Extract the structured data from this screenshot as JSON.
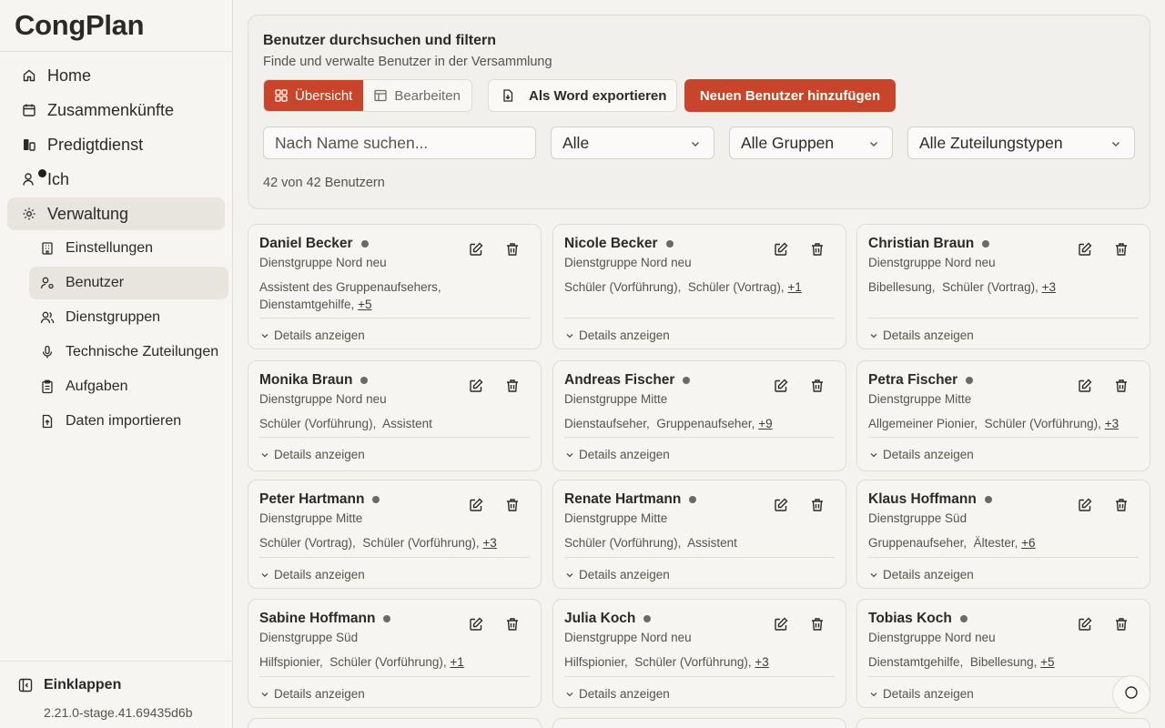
{
  "app": {
    "title": "CongPlan",
    "version": "2.21.0-stage.41.69435d6b"
  },
  "sidebar": {
    "items": [
      {
        "label": "Home",
        "icon": "home-icon"
      },
      {
        "label": "Zusammenkünfte",
        "icon": "calendar-icon"
      },
      {
        "label": "Predigtdienst",
        "icon": "ministry-icon"
      },
      {
        "label": "Ich",
        "icon": "user-icon"
      },
      {
        "label": "Verwaltung",
        "icon": "gear-icon"
      }
    ],
    "subitems": [
      {
        "label": "Einstellungen",
        "icon": "building-icon"
      },
      {
        "label": "Benutzer",
        "icon": "user-settings-icon"
      },
      {
        "label": "Dienstgruppen",
        "icon": "users-icon"
      },
      {
        "label": "Technische Zuteilungen",
        "icon": "microphone-icon"
      },
      {
        "label": "Aufgaben",
        "icon": "clipboard-icon"
      },
      {
        "label": "Daten importieren",
        "icon": "file-import-icon"
      }
    ],
    "collapse_label": "Einklappen"
  },
  "filter": {
    "title": "Benutzer durchsuchen und filtern",
    "subtitle": "Finde und verwalte Benutzer in der Versammlung",
    "view_overview": "Übersicht",
    "view_edit": "Bearbeiten",
    "export_label": "Als Word exportieren",
    "add_label": "Neuen Benutzer hinzufügen",
    "search_placeholder": "Nach Name suchen...",
    "select_status": "Alle",
    "select_groups": "Alle Gruppen",
    "select_types": "Alle Zuteilungstypen",
    "count_text": "42 von 42 Benutzern"
  },
  "details_label": "Details anzeigen",
  "users": [
    {
      "name": "Daniel Becker",
      "group": "Dienstgruppe Nord neu",
      "roles": [
        "Assistent des Gruppenaufsehers,",
        "Dienstamtgehilfe,"
      ],
      "more": "+5"
    },
    {
      "name": "Nicole Becker",
      "group": "Dienstgruppe Nord neu",
      "roles": [
        "Schüler (Vorführung),",
        "Schüler (Vortrag),"
      ],
      "more": "+1"
    },
    {
      "name": "Christian Braun",
      "group": "Dienstgruppe Nord neu",
      "roles": [
        "Bibellesung,",
        "Schüler (Vortrag),"
      ],
      "more": "+3"
    },
    {
      "name": "Monika Braun",
      "group": "Dienstgruppe Nord neu",
      "roles": [
        "Schüler (Vorführung),",
        "Assistent"
      ],
      "more": ""
    },
    {
      "name": "Andreas Fischer",
      "group": "Dienstgruppe Mitte",
      "roles": [
        "Dienstaufseher,",
        "Gruppenaufseher,"
      ],
      "more": "+9"
    },
    {
      "name": "Petra Fischer",
      "group": "Dienstgruppe Mitte",
      "roles": [
        "Allgemeiner Pionier,",
        "Schüler (Vorführung),"
      ],
      "more": "+3"
    },
    {
      "name": "Peter Hartmann",
      "group": "Dienstgruppe Mitte",
      "roles": [
        "Schüler (Vortrag),",
        "Schüler (Vorführung),"
      ],
      "more": "+3"
    },
    {
      "name": "Renate Hartmann",
      "group": "Dienstgruppe Mitte",
      "roles": [
        "Schüler (Vorführung),",
        "Assistent"
      ],
      "more": ""
    },
    {
      "name": "Klaus Hoffmann",
      "group": "Dienstgruppe Süd",
      "roles": [
        "Gruppenaufseher,",
        "Ältester,"
      ],
      "more": "+6"
    },
    {
      "name": "Sabine Hoffmann",
      "group": "Dienstgruppe Süd",
      "roles": [
        "Hilfspionier,",
        "Schüler (Vorführung),"
      ],
      "more": "+1"
    },
    {
      "name": "Julia Koch",
      "group": "Dienstgruppe Nord neu",
      "roles": [
        "Hilfspionier,",
        "Schüler (Vorführung),"
      ],
      "more": "+3"
    },
    {
      "name": "Tobias Koch",
      "group": "Dienstgruppe Nord neu",
      "roles": [
        "Dienstamtgehilfe,",
        "Bibellesung,"
      ],
      "more": "+5"
    }
  ]
}
